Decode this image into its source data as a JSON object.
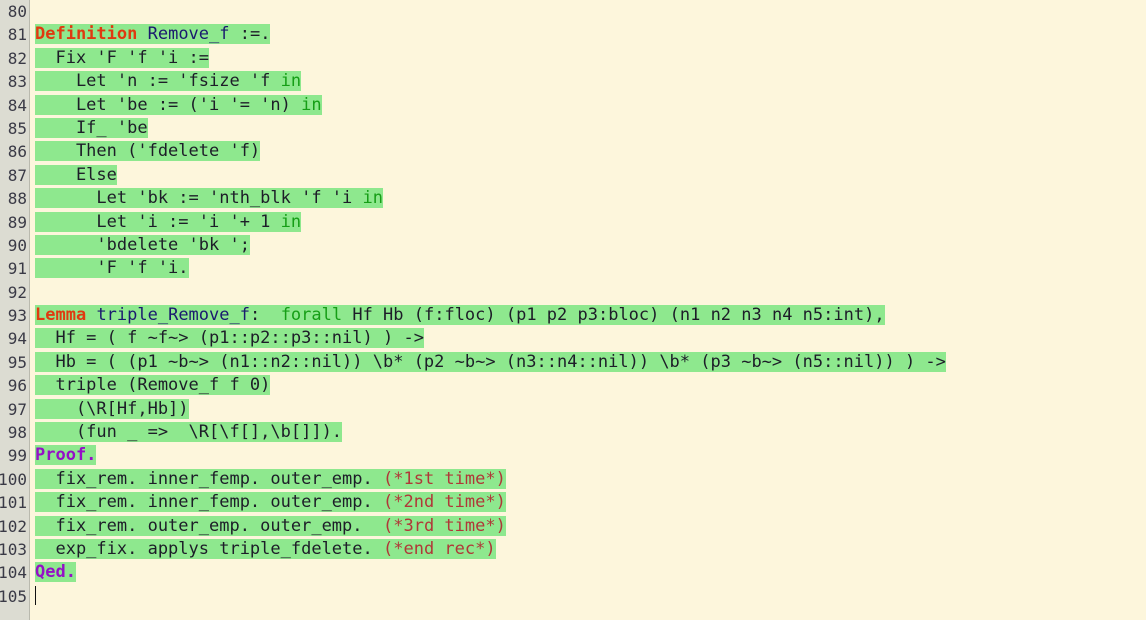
{
  "app": {
    "name": "coq-ide-proof-editor",
    "gutter_first_line": 80,
    "colors": {
      "background": "#fdf6dc",
      "processed_highlight": "#8ee88e",
      "gutter_background": "#dcdcd2",
      "vernacular_keyword": "#e03a10",
      "proof_keyword": "#9510c6",
      "identifier": "#1a1a6e",
      "green_keyword": "#169e16",
      "comment": "#b03838",
      "text": "#1d1d28"
    }
  },
  "gutter": {
    "line_numbers": [
      "80",
      "81",
      "82",
      "83",
      "84",
      "85",
      "86",
      "87",
      "88",
      "89",
      "90",
      "91",
      "92",
      "93",
      "94",
      "95",
      "96",
      "97",
      "98",
      "99",
      "100",
      "101",
      "102",
      "103",
      "104",
      "105"
    ]
  },
  "code": {
    "lines": [
      {
        "n": "80",
        "processed": false,
        "segs": []
      },
      {
        "n": "81",
        "processed": true,
        "segs": [
          {
            "t": "Definition",
            "c": "kw-vernac"
          },
          {
            "t": " ",
            "c": "plain"
          },
          {
            "t": "Remove_f",
            "c": "ident"
          },
          {
            "t": " :=.",
            "c": "plain"
          }
        ]
      },
      {
        "n": "82",
        "processed": true,
        "segs": [
          {
            "t": "  Fix 'F 'f 'i :=",
            "c": "plain"
          }
        ]
      },
      {
        "n": "83",
        "processed": true,
        "segs": [
          {
            "t": "    Let 'n := 'fsize 'f ",
            "c": "plain"
          },
          {
            "t": "in",
            "c": "kw-green"
          }
        ]
      },
      {
        "n": "84",
        "processed": true,
        "segs": [
          {
            "t": "    Let 'be := ('i '= 'n) ",
            "c": "plain"
          },
          {
            "t": "in",
            "c": "kw-green"
          }
        ]
      },
      {
        "n": "85",
        "processed": true,
        "segs": [
          {
            "t": "    If_ 'be",
            "c": "plain"
          }
        ]
      },
      {
        "n": "86",
        "processed": true,
        "segs": [
          {
            "t": "    Then ('fdelete 'f)",
            "c": "plain"
          }
        ]
      },
      {
        "n": "87",
        "processed": true,
        "segs": [
          {
            "t": "    Else",
            "c": "plain"
          }
        ]
      },
      {
        "n": "88",
        "processed": true,
        "segs": [
          {
            "t": "      Let 'bk := 'nth_blk 'f 'i ",
            "c": "plain"
          },
          {
            "t": "in",
            "c": "kw-green"
          }
        ]
      },
      {
        "n": "89",
        "processed": true,
        "segs": [
          {
            "t": "      Let 'i := 'i '+ 1 ",
            "c": "plain"
          },
          {
            "t": "in",
            "c": "kw-green"
          }
        ]
      },
      {
        "n": "90",
        "processed": true,
        "segs": [
          {
            "t": "      'bdelete 'bk ';",
            "c": "plain"
          }
        ]
      },
      {
        "n": "91",
        "processed": true,
        "segs": [
          {
            "t": "      'F 'f 'i.",
            "c": "plain"
          }
        ]
      },
      {
        "n": "92",
        "processed": false,
        "segs": []
      },
      {
        "n": "93",
        "processed": true,
        "segs": [
          {
            "t": "Lemma",
            "c": "kw-vernac"
          },
          {
            "t": " ",
            "c": "plain"
          },
          {
            "t": "triple_Remove_f",
            "c": "ident"
          },
          {
            "t": ":  ",
            "c": "plain"
          },
          {
            "t": "forall",
            "c": "kw-green"
          },
          {
            "t": " Hf Hb (f:floc) (p1 p2 p3:bloc) (n1 n2 n3 n4 n5:int),",
            "c": "plain"
          }
        ]
      },
      {
        "n": "94",
        "processed": true,
        "segs": [
          {
            "t": "  Hf = ( f ~f~> (p1::p2::p3::nil) ) ->",
            "c": "plain"
          }
        ]
      },
      {
        "n": "95",
        "processed": true,
        "segs": [
          {
            "t": "  Hb = ( (p1 ~b~> (n1::n2::nil)) \\b* (p2 ~b~> (n3::n4::nil)) \\b* (p3 ~b~> (n5::nil)) ) ->",
            "c": "plain"
          }
        ]
      },
      {
        "n": "96",
        "processed": true,
        "segs": [
          {
            "t": "  triple (Remove_f f 0)",
            "c": "plain"
          }
        ]
      },
      {
        "n": "97",
        "processed": true,
        "segs": [
          {
            "t": "    (\\R[Hf,Hb])",
            "c": "plain"
          }
        ]
      },
      {
        "n": "98",
        "processed": true,
        "segs": [
          {
            "t": "    (fun _ =>  \\R[\\f[],\\b[]]).",
            "c": "plain"
          }
        ]
      },
      {
        "n": "99",
        "processed": true,
        "segs": [
          {
            "t": "Proof.",
            "c": "kw-proof"
          }
        ]
      },
      {
        "n": "100",
        "processed": true,
        "segs": [
          {
            "t": "  fix_rem. inner_femp. outer_emp. ",
            "c": "plain"
          },
          {
            "t": "(*1st time*)",
            "c": "comment"
          }
        ]
      },
      {
        "n": "101",
        "processed": true,
        "segs": [
          {
            "t": "  fix_rem. inner_femp. outer_emp. ",
            "c": "plain"
          },
          {
            "t": "(*2nd time*)",
            "c": "comment"
          }
        ]
      },
      {
        "n": "102",
        "processed": true,
        "segs": [
          {
            "t": "  fix_rem. outer_emp. outer_emp.  ",
            "c": "plain"
          },
          {
            "t": "(*3rd time*)",
            "c": "comment"
          }
        ]
      },
      {
        "n": "103",
        "processed": true,
        "segs": [
          {
            "t": "  exp_fix. applys triple_fdelete. ",
            "c": "plain"
          },
          {
            "t": "(*end rec*)",
            "c": "comment"
          }
        ]
      },
      {
        "n": "104",
        "processed": true,
        "segs": [
          {
            "t": "Qed.",
            "c": "kw-proof"
          }
        ]
      },
      {
        "n": "105",
        "processed": false,
        "segs": []
      }
    ]
  },
  "cursor": {
    "line": "105",
    "column": 1,
    "visible": true
  }
}
